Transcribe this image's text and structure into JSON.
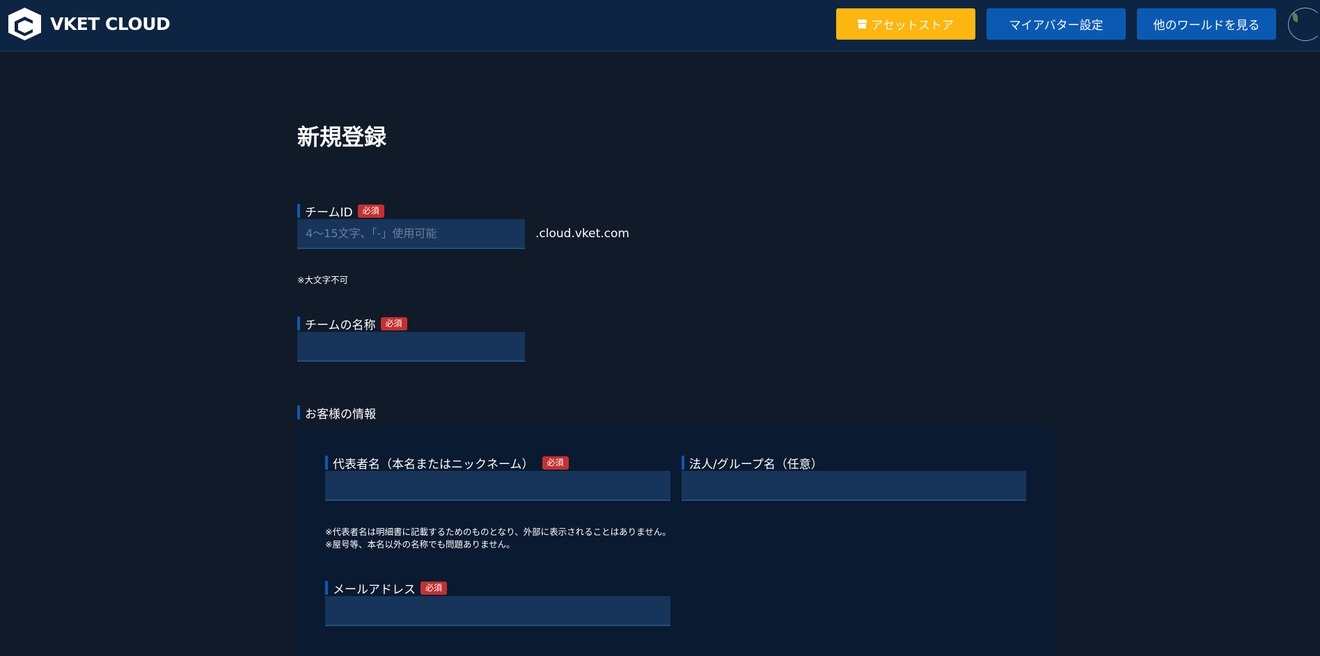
{
  "header": {
    "brand": "VKET CLOUD",
    "buttons": {
      "asset_store": "アセットストア",
      "my_avatar": "マイアバター設定",
      "other_worlds": "他のワールドを見る"
    }
  },
  "page": {
    "title": "新規登録"
  },
  "form": {
    "team_id": {
      "label": "チームID",
      "badge": "必須",
      "placeholder": "4〜15文字、「-」使用可能",
      "suffix": ".cloud.vket.com",
      "note": "※大文字不可"
    },
    "team_name": {
      "label": "チームの名称",
      "badge": "必須"
    },
    "customer_section": {
      "label": "お客様の情報"
    },
    "representative": {
      "label": "代表者名（本名またはニックネーム）",
      "badge": "必須",
      "note_1": "※代表者名は明細書に記載するためのものとなり、外部に表示されることはありません。",
      "note_2": "※屋号等、本名以外の名称でも問題ありません。"
    },
    "company": {
      "label": "法人/グループ名（任意）"
    },
    "email": {
      "label": "メールアドレス",
      "badge": "必須"
    }
  },
  "colors": {
    "background": "#111a29",
    "header": "#0d2442",
    "accent_blue": "#0a5ab3",
    "store_yellow": "#fdb60f",
    "required_red": "#c53030",
    "input_bg": "#17345a"
  }
}
